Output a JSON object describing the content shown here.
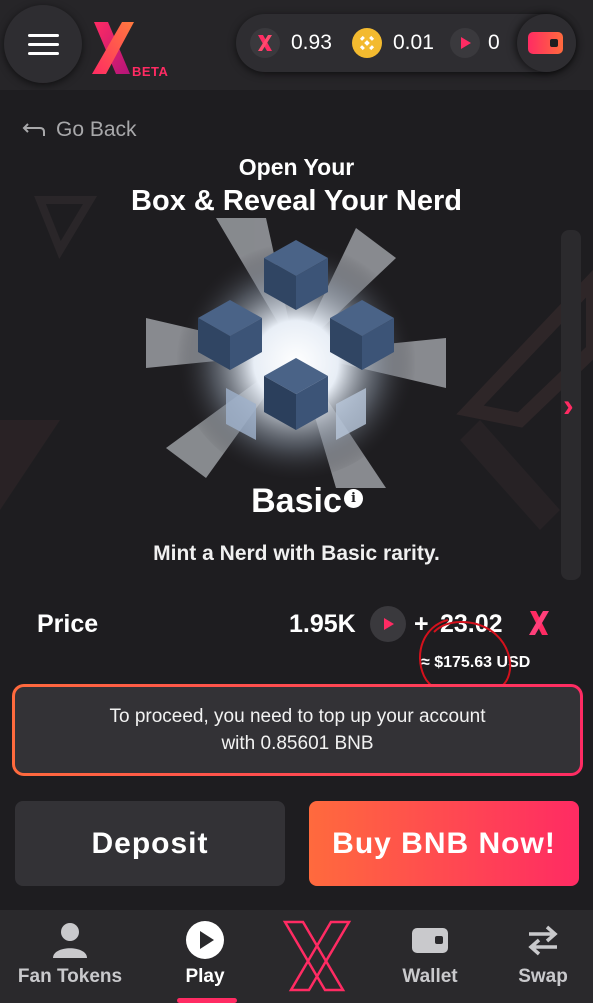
{
  "header": {
    "logo_text": "X",
    "beta_label": "BETA",
    "balances": [
      {
        "icon": "x-token-icon",
        "value": "0.93"
      },
      {
        "icon": "bnb-coin-icon",
        "value": "0.01"
      },
      {
        "icon": "nerd-token-icon",
        "value": "0"
      }
    ]
  },
  "main": {
    "go_back": "Go Back",
    "title_line1": "Open Your",
    "title_line2": "Box & Reveal Your Nerd",
    "box_name": "Basic",
    "box_description": "Mint a Nerd with Basic rarity.",
    "price": {
      "label": "Price",
      "nerd_amount": "1.95K",
      "plus": "+",
      "x_amount": "23.02",
      "usd_equivalent": "≈ $175.63 USD"
    },
    "notice": {
      "line1": "To proceed, you need to top up your account",
      "line2": "with 0.85601 BNB"
    },
    "buttons": {
      "deposit": "Deposit",
      "buy": "Buy BNB Now!"
    }
  },
  "nav": {
    "items": [
      {
        "label": "Fan Tokens",
        "icon": "user-icon"
      },
      {
        "label": "Play",
        "icon": "play-icon"
      },
      {
        "label": "X",
        "icon": "x-logo-icon"
      },
      {
        "label": "Wallet",
        "icon": "wallet-icon"
      },
      {
        "label": "Swap",
        "icon": "swap-icon"
      }
    ],
    "active_index": 1
  },
  "colors": {
    "accent": "#ff2b63",
    "accent_orange": "#ff6a3d",
    "background": "#1e1d20",
    "panel": "#333236",
    "bnb_gold": "#f3ba2f"
  }
}
